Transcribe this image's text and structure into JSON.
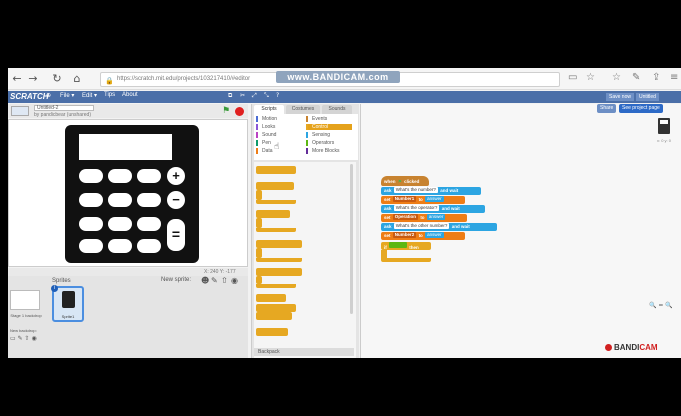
{
  "browser": {
    "url": "https://scratch.mit.edu/projects/103217410/#editor",
    "watermark": "www.BANDICAM.com",
    "back": "←",
    "forward": "→",
    "reload": "↻",
    "home": "⌂",
    "star": "☆",
    "menu": "≡"
  },
  "menu_bar": {
    "logo": "SCRATCH",
    "items": [
      "File ▾",
      "Edit ▾",
      "Tips",
      "About"
    ],
    "right_items": [
      "Save now",
      "Untitled"
    ]
  },
  "stage": {
    "project_title": "Untitled-2",
    "author": "by pandicbear (unshared)",
    "coords": "X: 240 Y: -177",
    "calc_op_plus": "+",
    "calc_op_minus": "−",
    "calc_op_equals": "="
  },
  "sprites": {
    "label": "Sprites",
    "new_sprite_label": "New sprite:",
    "stage_thumb_label": "Stage 1 backdrop",
    "new_backdrop_label": "New backdrop:",
    "sprite_name": "Sprite1",
    "badge": "i"
  },
  "palette": {
    "tabs": [
      "Scripts",
      "Costumes",
      "Sounds"
    ],
    "categories": [
      {
        "label": "Motion",
        "color": "#4a6cd4"
      },
      {
        "label": "Events",
        "color": "#c88330"
      },
      {
        "label": "Looks",
        "color": "#8a55d7"
      },
      {
        "label": "Control",
        "color": "#e6a822"
      },
      {
        "label": "Sound",
        "color": "#bb42c3"
      },
      {
        "label": "Sensing",
        "color": "#2ca5e2"
      },
      {
        "label": "Pen",
        "color": "#0e9a6c"
      },
      {
        "label": "Operators",
        "color": "#5cb712"
      },
      {
        "label": "Data",
        "color": "#ee7d16"
      },
      {
        "label": "More Blocks",
        "color": "#632d99"
      }
    ],
    "backpack_label": "Backpack"
  },
  "scripts": {
    "share_label": "Share",
    "see_page_label": "See project page",
    "xy_readout": "x: 0 y: 0",
    "zoom": "🔍 = 🔍",
    "hat_when": "when",
    "hat_clicked": "clicked",
    "ask1_pre": "ask",
    "ask1_text": "What's the number?",
    "ask1_post": "and wait",
    "set1_pre": "set",
    "set1_var": "Number1",
    "set1_mid": "to",
    "set1_val": "answer",
    "ask2_pre": "ask",
    "ask2_text": "What's the operator?",
    "ask2_post": "and wait",
    "set2_pre": "set",
    "set2_var": "Operation",
    "set2_mid": "to",
    "set2_val": "answer",
    "ask3_pre": "ask",
    "ask3_text": "What's the other number?",
    "ask3_post": "and wait",
    "set3_pre": "set",
    "set3_var": "Number2",
    "set3_mid": "to",
    "set3_val": "answer",
    "if_pre": "if",
    "if_cond": "",
    "if_then": "then"
  },
  "bandicam": {
    "label_a": "BANDI",
    "label_b": "CAM"
  }
}
